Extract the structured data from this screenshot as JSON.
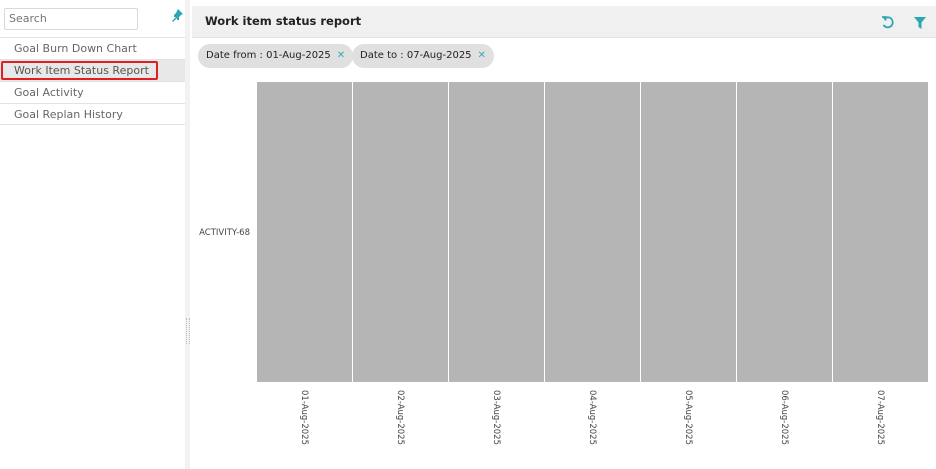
{
  "sidebar": {
    "search_placeholder": "Search",
    "items": [
      {
        "label": "Goal Burn Down Chart"
      },
      {
        "label": "Work Item Status Report",
        "active": true
      },
      {
        "label": "Goal Activity"
      },
      {
        "label": "Goal Replan History"
      }
    ]
  },
  "header": {
    "title": "Work item status report"
  },
  "filters": [
    {
      "label": "Date from : 01-Aug-2025"
    },
    {
      "label": "Date to : 07-Aug-2025"
    }
  ],
  "colors": {
    "cell": "#b5b5b5",
    "accent": "#2aa7b3",
    "active_outline": "#e02020"
  },
  "chart_data": {
    "type": "heatmap",
    "y_categories": [
      "ACTIVITY-68"
    ],
    "x_categories": [
      "01-Aug-2025",
      "02-Aug-2025",
      "03-Aug-2025",
      "04-Aug-2025",
      "05-Aug-2025",
      "06-Aug-2025",
      "07-Aug-2025"
    ],
    "values": [
      [
        0,
        0,
        0,
        0,
        0,
        0,
        0
      ]
    ]
  }
}
